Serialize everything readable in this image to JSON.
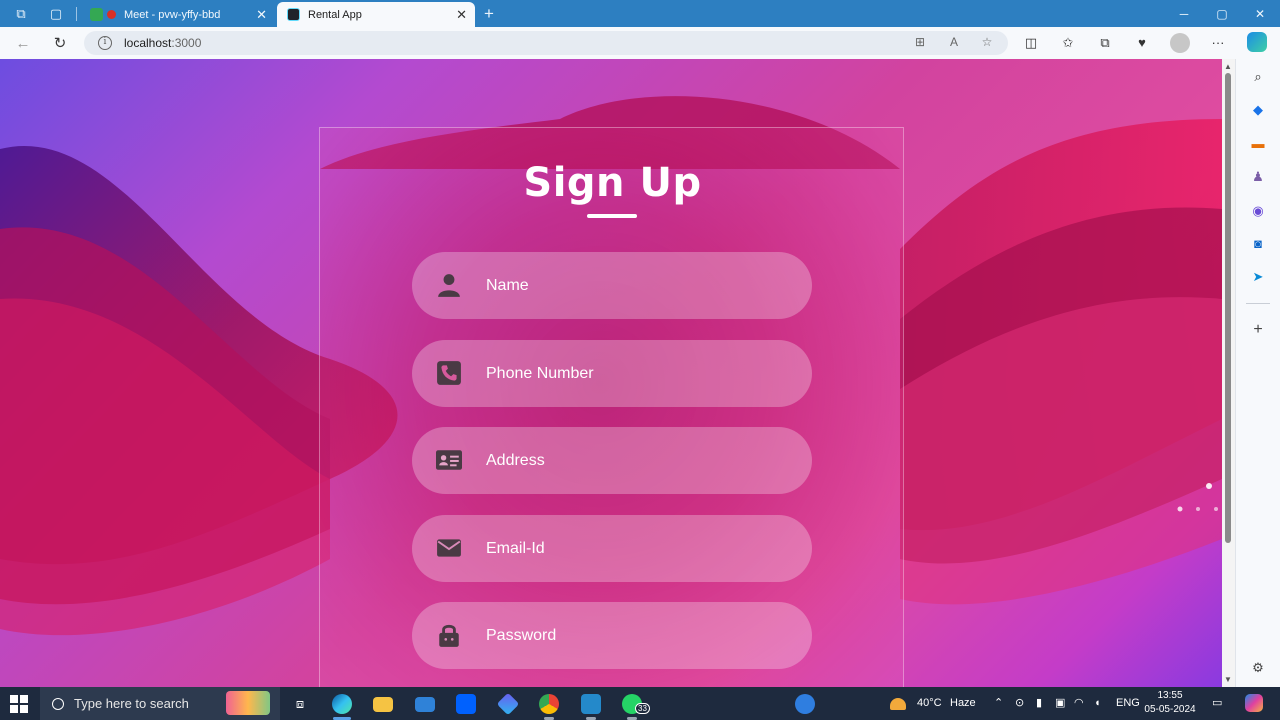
{
  "browser": {
    "tabs": [
      {
        "title": "Meet - pvw-yffy-bbd",
        "active": false
      },
      {
        "title": "Rental App",
        "active": true
      }
    ],
    "new_tab_label": "+",
    "address": {
      "host": "localhost",
      "port": ":3000"
    }
  },
  "page": {
    "title": "Sign Up",
    "fields": [
      {
        "placeholder": "Name",
        "icon": "person-icon",
        "type": "text"
      },
      {
        "placeholder": "Phone Number",
        "icon": "phone-icon",
        "type": "tel"
      },
      {
        "placeholder": "Address",
        "icon": "address-card-icon",
        "type": "text"
      },
      {
        "placeholder": "Email-Id",
        "icon": "envelope-icon",
        "type": "email"
      },
      {
        "placeholder": "Password",
        "icon": "lock-icon",
        "type": "password"
      }
    ],
    "colors": {
      "accent": "#e0409a",
      "field_icon": "#4a3a44"
    }
  },
  "taskbar": {
    "search_placeholder": "Type here to search",
    "whatsapp_badge": "33",
    "weather": {
      "temp": "40°C",
      "condition": "Haze"
    },
    "language": "ENG",
    "time": "13:55",
    "date": "05-05-2024"
  }
}
